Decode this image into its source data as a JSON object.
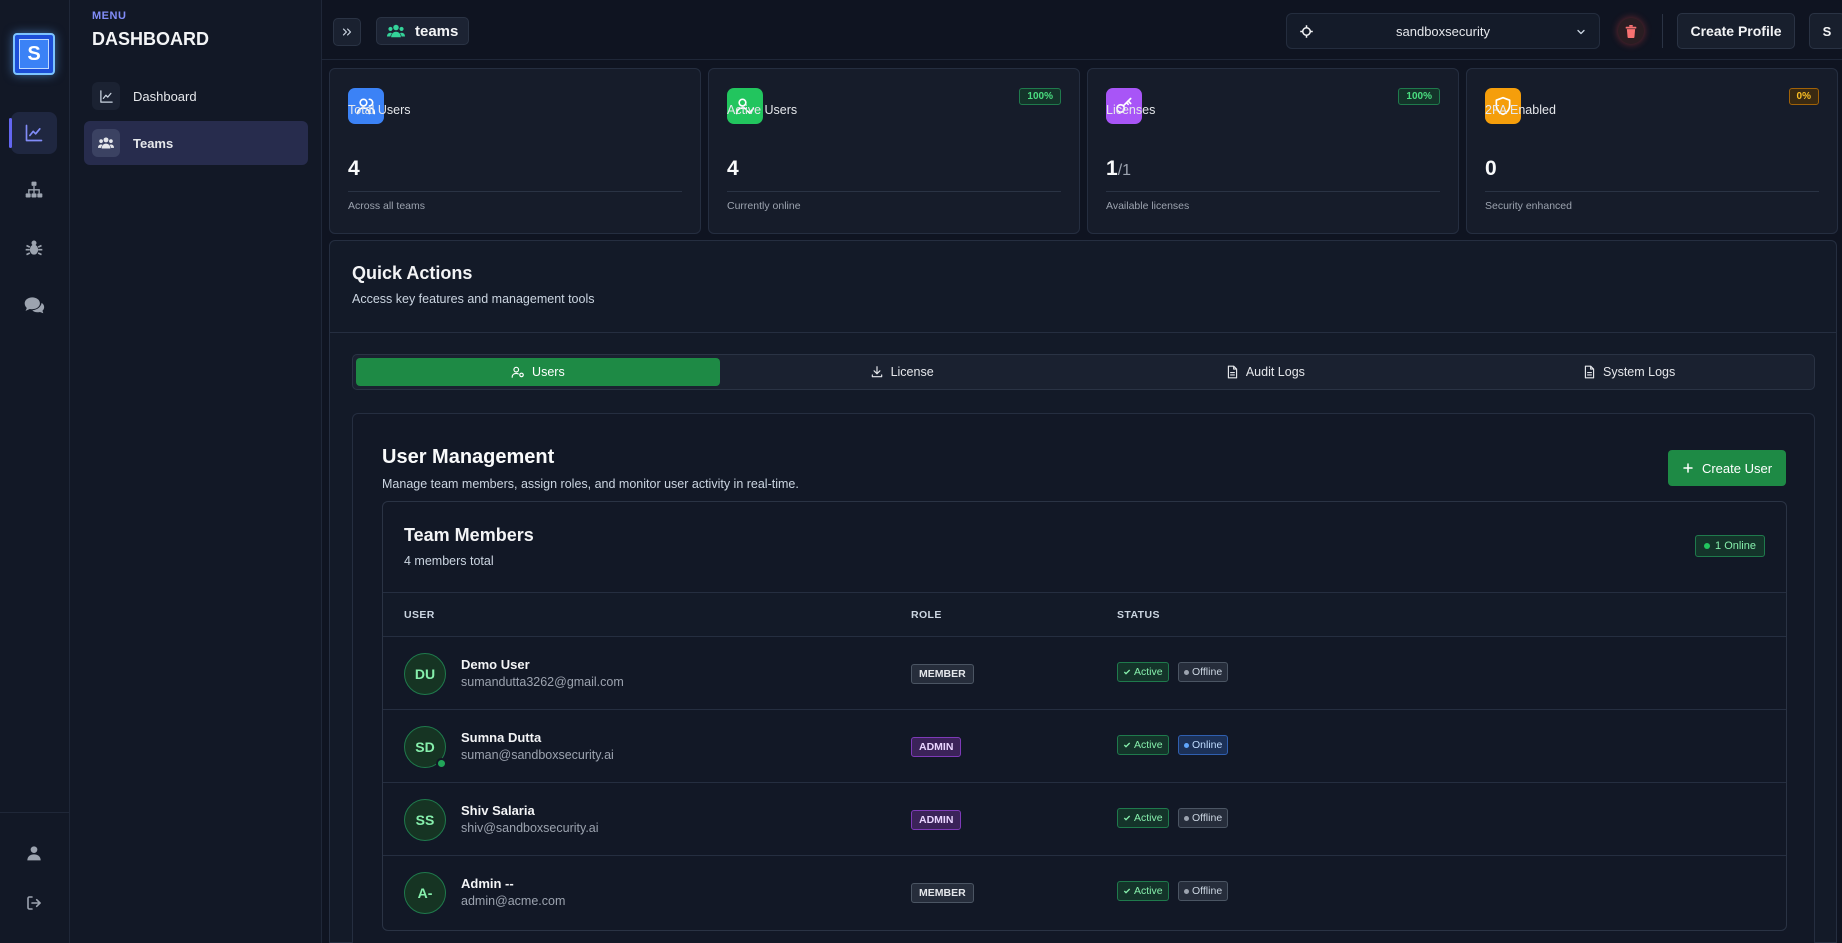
{
  "rail": {
    "logo_letter": "S",
    "icons": [
      "chart-line-icon",
      "org-chart-icon",
      "bug-icon",
      "chat-icon",
      "user-icon",
      "sign-out-icon"
    ]
  },
  "menu": {
    "label": "MENU",
    "title": "DASHBOARD",
    "items": [
      {
        "label": "Dashboard",
        "icon": "chart-line-icon",
        "active": false
      },
      {
        "label": "Teams",
        "icon": "users-icon",
        "active": true
      }
    ]
  },
  "topbar": {
    "breadcrumb": "teams",
    "org_select": "sandboxsecurity",
    "create_profile": "Create Profile",
    "avatar_initial": "S"
  },
  "stats": [
    {
      "label": "Total Users",
      "value": "4",
      "value_sub": "",
      "note": "Across all teams",
      "badge": "",
      "icon": "users-icon",
      "color": "#3b82f6"
    },
    {
      "label": "Active Users",
      "value": "4",
      "value_sub": "",
      "note": "Currently online",
      "badge": "100%",
      "icon": "user-check-icon",
      "color": "#22c55e"
    },
    {
      "label": "Licenses",
      "value": "1",
      "value_sub": "/1",
      "note": "Available licenses",
      "badge": "100%",
      "icon": "key-icon",
      "color": "#a855f7"
    },
    {
      "label": "2FA Enabled",
      "value": "0",
      "value_sub": "",
      "note": "Security enhanced",
      "badge": "0%",
      "icon": "shield-icon",
      "color": "#f59e0b"
    }
  ],
  "quick_actions": {
    "title": "Quick Actions",
    "subtitle": "Access key features and management tools",
    "tabs": [
      {
        "label": "Users",
        "icon": "user-cog-icon",
        "active": true
      },
      {
        "label": "License",
        "icon": "download-icon",
        "active": false
      },
      {
        "label": "Audit Logs",
        "icon": "file-icon",
        "active": false
      },
      {
        "label": "System Logs",
        "icon": "file-icon",
        "active": false
      }
    ]
  },
  "user_management": {
    "title": "User Management",
    "subtitle": "Manage team members, assign roles, and monitor user activity in real-time.",
    "create_user": "Create User",
    "team": {
      "title": "Team Members",
      "subtitle": "4 members total",
      "online_badge": "1 Online",
      "columns": [
        "USER",
        "ROLE",
        "STATUS"
      ],
      "members": [
        {
          "initials": "DU",
          "name": "Demo User",
          "email": "sumandutta3262@gmail.com",
          "role": "MEMBER",
          "status": "Active",
          "presence": "Offline"
        },
        {
          "initials": "SD",
          "name": "Sumna Dutta",
          "email": "suman@sandboxsecurity.ai",
          "role": "ADMIN",
          "status": "Active",
          "presence": "Online"
        },
        {
          "initials": "SS",
          "name": "Shiv Salaria",
          "email": "shiv@sandboxsecurity.ai",
          "role": "ADMIN",
          "status": "Active",
          "presence": "Offline"
        },
        {
          "initials": "A-",
          "name": "Admin --",
          "email": "admin@acme.com",
          "role": "MEMBER",
          "status": "Active",
          "presence": "Offline"
        }
      ]
    }
  }
}
